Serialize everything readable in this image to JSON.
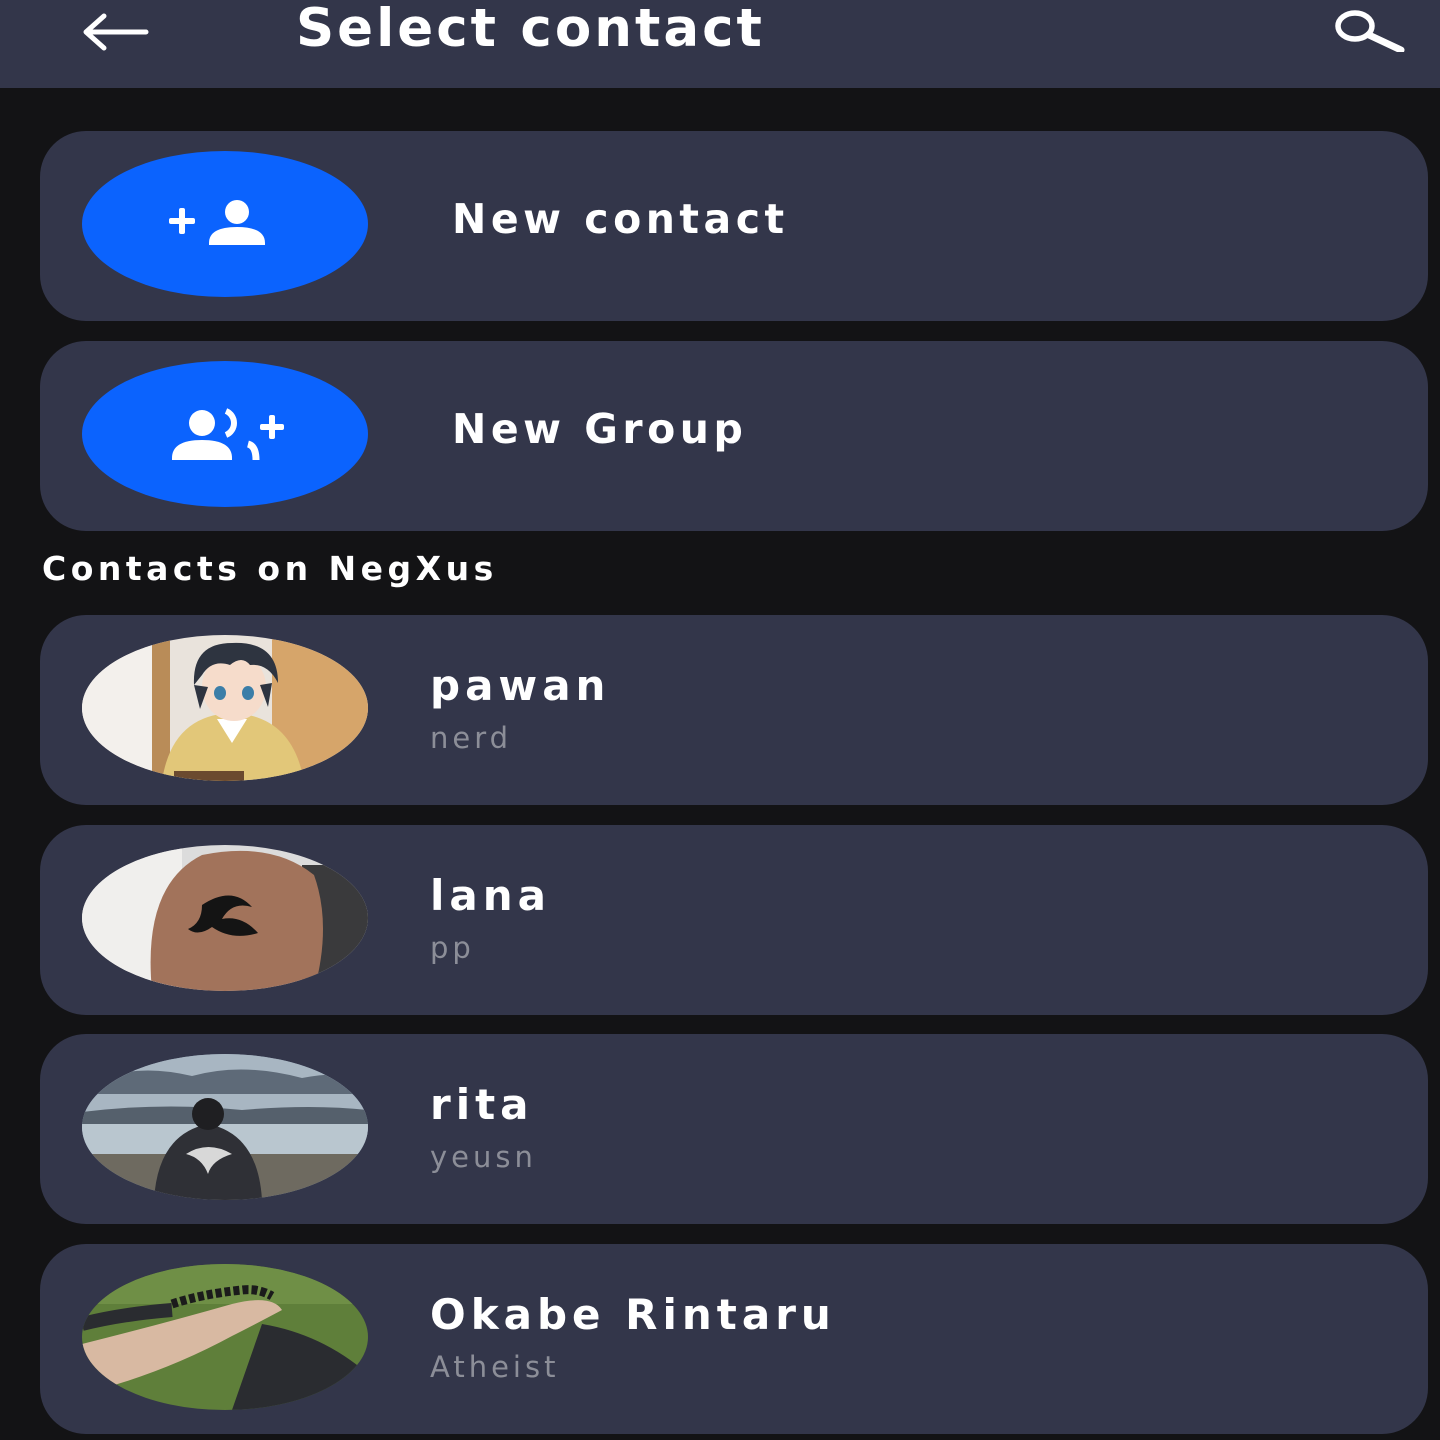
{
  "header": {
    "title": "Select contact",
    "back_icon": "arrow-left-icon",
    "search_icon": "search-icon",
    "background": "#33364a"
  },
  "actions": [
    {
      "label": "New contact",
      "icon": "person-add-icon"
    },
    {
      "label": "New Group",
      "icon": "group-add-icon"
    }
  ],
  "section": {
    "title": "Contacts on NegXus"
  },
  "contacts": [
    {
      "name": "pawan",
      "status": "nerd",
      "avatar": "anime-character-avatar"
    },
    {
      "name": "lana",
      "status": "pp",
      "avatar": "tattoo-arm-avatar"
    },
    {
      "name": "rita",
      "status": "yeusn",
      "avatar": "person-at-lake-avatar"
    },
    {
      "name": "Okabe Rintaru",
      "status": "Atheist",
      "avatar": "arm-on-grass-avatar"
    }
  ],
  "colors": {
    "accent": "#0b63fe",
    "card": "#33364a",
    "background": "#131315",
    "secondary_text": "#8c8e98"
  }
}
